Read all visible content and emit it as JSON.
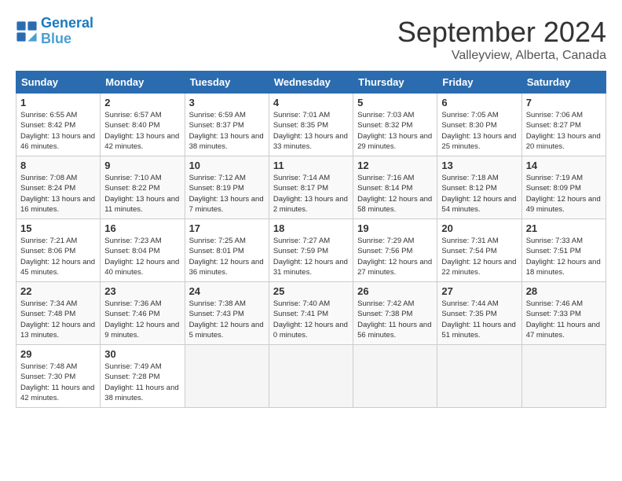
{
  "header": {
    "logo_line1": "General",
    "logo_line2": "Blue",
    "month": "September 2024",
    "location": "Valleyview, Alberta, Canada"
  },
  "days_of_week": [
    "Sunday",
    "Monday",
    "Tuesday",
    "Wednesday",
    "Thursday",
    "Friday",
    "Saturday"
  ],
  "weeks": [
    [
      {
        "day": "1",
        "sunrise": "6:55 AM",
        "sunset": "8:42 PM",
        "daylight": "13 hours and 46 minutes."
      },
      {
        "day": "2",
        "sunrise": "6:57 AM",
        "sunset": "8:40 PM",
        "daylight": "13 hours and 42 minutes."
      },
      {
        "day": "3",
        "sunrise": "6:59 AM",
        "sunset": "8:37 PM",
        "daylight": "13 hours and 38 minutes."
      },
      {
        "day": "4",
        "sunrise": "7:01 AM",
        "sunset": "8:35 PM",
        "daylight": "13 hours and 33 minutes."
      },
      {
        "day": "5",
        "sunrise": "7:03 AM",
        "sunset": "8:32 PM",
        "daylight": "13 hours and 29 minutes."
      },
      {
        "day": "6",
        "sunrise": "7:05 AM",
        "sunset": "8:30 PM",
        "daylight": "13 hours and 25 minutes."
      },
      {
        "day": "7",
        "sunrise": "7:06 AM",
        "sunset": "8:27 PM",
        "daylight": "13 hours and 20 minutes."
      }
    ],
    [
      {
        "day": "8",
        "sunrise": "7:08 AM",
        "sunset": "8:24 PM",
        "daylight": "13 hours and 16 minutes."
      },
      {
        "day": "9",
        "sunrise": "7:10 AM",
        "sunset": "8:22 PM",
        "daylight": "13 hours and 11 minutes."
      },
      {
        "day": "10",
        "sunrise": "7:12 AM",
        "sunset": "8:19 PM",
        "daylight": "13 hours and 7 minutes."
      },
      {
        "day": "11",
        "sunrise": "7:14 AM",
        "sunset": "8:17 PM",
        "daylight": "13 hours and 2 minutes."
      },
      {
        "day": "12",
        "sunrise": "7:16 AM",
        "sunset": "8:14 PM",
        "daylight": "12 hours and 58 minutes."
      },
      {
        "day": "13",
        "sunrise": "7:18 AM",
        "sunset": "8:12 PM",
        "daylight": "12 hours and 54 minutes."
      },
      {
        "day": "14",
        "sunrise": "7:19 AM",
        "sunset": "8:09 PM",
        "daylight": "12 hours and 49 minutes."
      }
    ],
    [
      {
        "day": "15",
        "sunrise": "7:21 AM",
        "sunset": "8:06 PM",
        "daylight": "12 hours and 45 minutes."
      },
      {
        "day": "16",
        "sunrise": "7:23 AM",
        "sunset": "8:04 PM",
        "daylight": "12 hours and 40 minutes."
      },
      {
        "day": "17",
        "sunrise": "7:25 AM",
        "sunset": "8:01 PM",
        "daylight": "12 hours and 36 minutes."
      },
      {
        "day": "18",
        "sunrise": "7:27 AM",
        "sunset": "7:59 PM",
        "daylight": "12 hours and 31 minutes."
      },
      {
        "day": "19",
        "sunrise": "7:29 AM",
        "sunset": "7:56 PM",
        "daylight": "12 hours and 27 minutes."
      },
      {
        "day": "20",
        "sunrise": "7:31 AM",
        "sunset": "7:54 PM",
        "daylight": "12 hours and 22 minutes."
      },
      {
        "day": "21",
        "sunrise": "7:33 AM",
        "sunset": "7:51 PM",
        "daylight": "12 hours and 18 minutes."
      }
    ],
    [
      {
        "day": "22",
        "sunrise": "7:34 AM",
        "sunset": "7:48 PM",
        "daylight": "12 hours and 13 minutes."
      },
      {
        "day": "23",
        "sunrise": "7:36 AM",
        "sunset": "7:46 PM",
        "daylight": "12 hours and 9 minutes."
      },
      {
        "day": "24",
        "sunrise": "7:38 AM",
        "sunset": "7:43 PM",
        "daylight": "12 hours and 5 minutes."
      },
      {
        "day": "25",
        "sunrise": "7:40 AM",
        "sunset": "7:41 PM",
        "daylight": "12 hours and 0 minutes."
      },
      {
        "day": "26",
        "sunrise": "7:42 AM",
        "sunset": "7:38 PM",
        "daylight": "11 hours and 56 minutes."
      },
      {
        "day": "27",
        "sunrise": "7:44 AM",
        "sunset": "7:35 PM",
        "daylight": "11 hours and 51 minutes."
      },
      {
        "day": "28",
        "sunrise": "7:46 AM",
        "sunset": "7:33 PM",
        "daylight": "11 hours and 47 minutes."
      }
    ],
    [
      {
        "day": "29",
        "sunrise": "7:48 AM",
        "sunset": "7:30 PM",
        "daylight": "11 hours and 42 minutes."
      },
      {
        "day": "30",
        "sunrise": "7:49 AM",
        "sunset": "7:28 PM",
        "daylight": "11 hours and 38 minutes."
      },
      null,
      null,
      null,
      null,
      null
    ]
  ]
}
